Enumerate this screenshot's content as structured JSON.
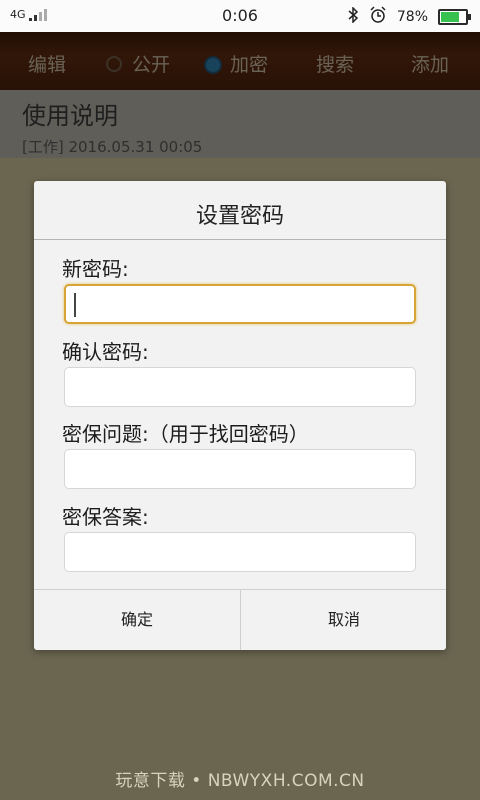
{
  "status_bar": {
    "network": "4G",
    "time": "0:06",
    "battery": "78%",
    "battery_level": 0.78,
    "icons": [
      "bluetooth-icon",
      "alarm-icon",
      "battery-icon"
    ]
  },
  "toolbar": {
    "edit": "编辑",
    "public": "公开",
    "encrypt": "加密",
    "search": "搜索",
    "add": "添加",
    "selected_option": "加密",
    "accent_color": "#2f78a6"
  },
  "note": {
    "title": "使用说明",
    "meta": "[工作] 2016.05.31 00:05"
  },
  "dialog": {
    "title": "设置密码",
    "new_password_label": "新密码:",
    "new_password_value": "",
    "confirm_password_label": "确认密码:",
    "confirm_password_value": "",
    "security_question_label": "密保问题:（用于找回密码）",
    "security_question_value": "",
    "security_answer_label": "密保答案:",
    "security_answer_value": "",
    "ok_button": "确定",
    "cancel_button": "取消",
    "focus_color": "#d7a438"
  },
  "watermark": "玩意下载 • NBWYXH.COM.CN"
}
